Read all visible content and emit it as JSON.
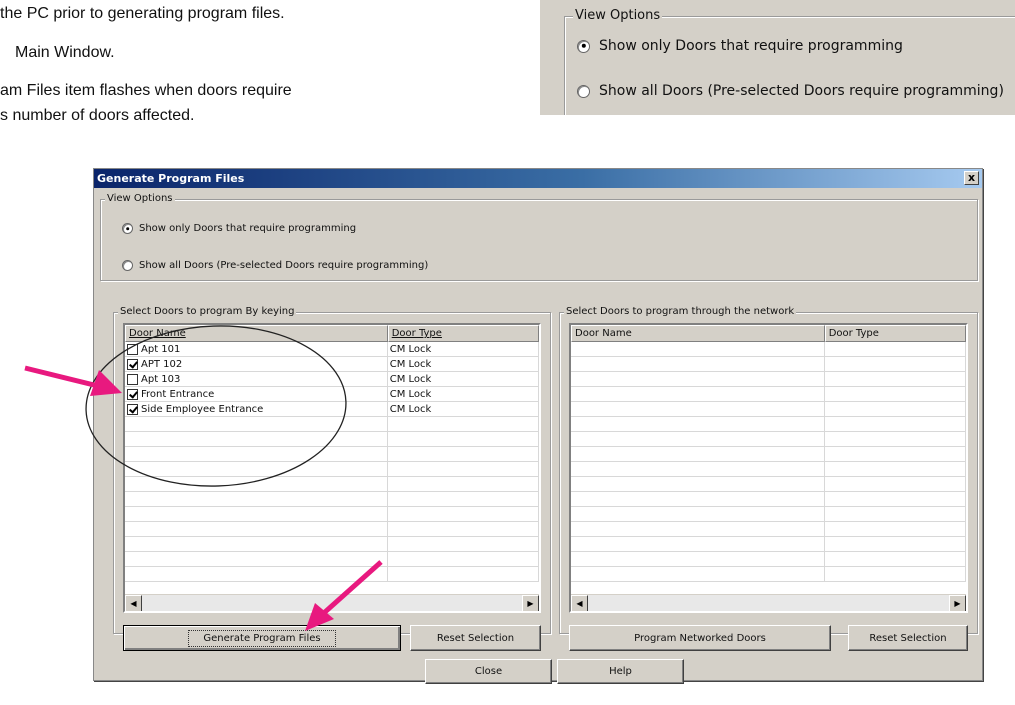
{
  "document": {
    "lines": [
      "the PC prior to generating program files.",
      "Main Window.",
      "am Files item flashes when doors require",
      "s number of doors affected."
    ]
  },
  "inset": {
    "group_title": "View Options",
    "option_required": "Show only Doors that require programming",
    "option_all": "Show all Doors (Pre-selected Doors require programming)"
  },
  "dialog": {
    "title": "Generate Program Files",
    "close_glyph": "x",
    "view_options": {
      "title": "View Options",
      "option_required": "Show only Doors that require programming",
      "option_all": "Show all Doors (Pre-selected Doors require programming)",
      "selected": "required"
    },
    "keying": {
      "title": "Select Doors to program By keying",
      "columns": [
        "Door Name",
        "Door Type"
      ],
      "rows": [
        {
          "name": "Apt 101",
          "type": "CM Lock",
          "checked": false
        },
        {
          "name": "APT 102",
          "type": "CM Lock",
          "checked": true
        },
        {
          "name": "Apt 103",
          "type": "CM Lock",
          "checked": false
        },
        {
          "name": "Front Entrance",
          "type": "CM Lock",
          "checked": true
        },
        {
          "name": "Side Employee Entrance",
          "type": "CM Lock",
          "checked": true
        }
      ],
      "generate_button": "Generate Program Files",
      "reset_button": "Reset Selection"
    },
    "network": {
      "title": "Select Doors to program through the network",
      "columns": [
        "Door Name",
        "Door Type"
      ],
      "rows": [],
      "program_button": "Program Networked Doors",
      "reset_button": "Reset Selection"
    },
    "close_button": "Close",
    "help_button": "Help"
  },
  "colors": {
    "annotation_arrow": "#e8197f",
    "titlebar_start": "#0a246a",
    "titlebar_end": "#a6caf0"
  }
}
